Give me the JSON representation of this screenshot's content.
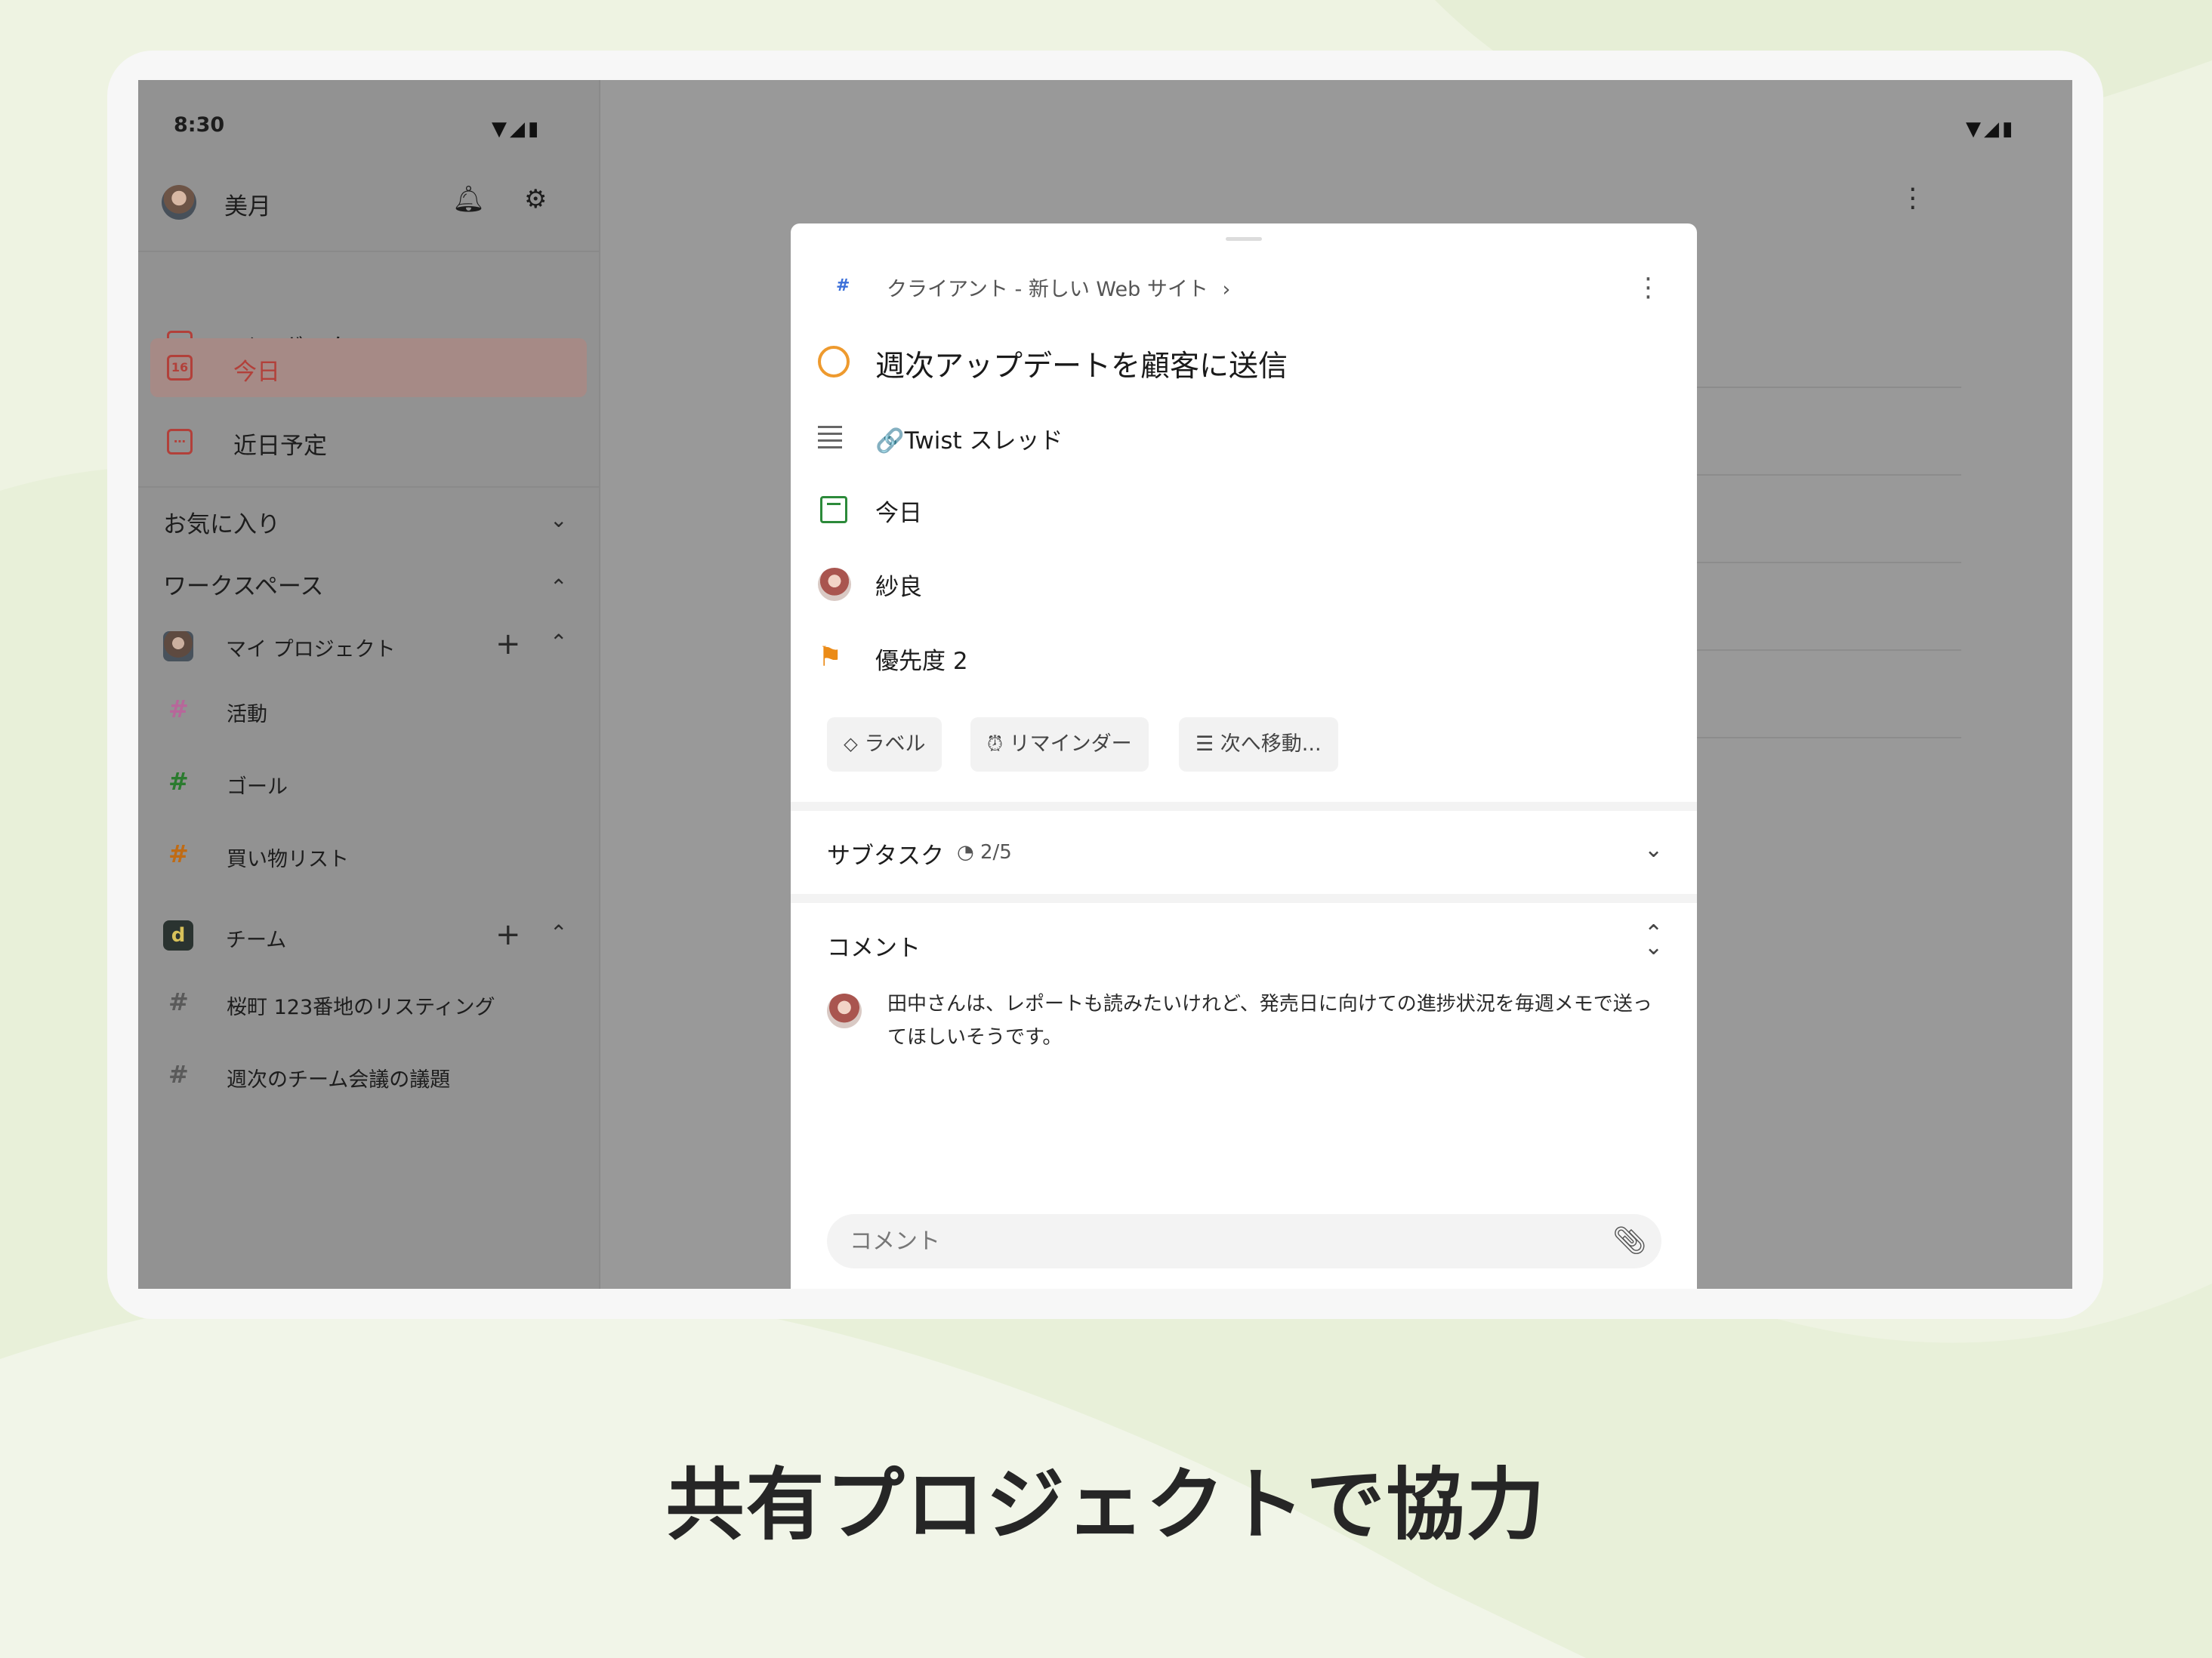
{
  "headline": "共有プロジェクトで協力",
  "status_bar": {
    "time": "8:30",
    "icons": "▼◢▮"
  },
  "sidebar": {
    "user_name": "美月",
    "nav": [
      {
        "label": "インボックス",
        "icon": "inbox-icon"
      },
      {
        "label": "今日",
        "icon": "today-icon",
        "badge": "16",
        "active": true
      },
      {
        "label": "近日予定",
        "icon": "upcoming-icon"
      }
    ],
    "favorites_label": "お気に入り",
    "workspace_label": "ワークスペース",
    "my_projects": {
      "label": "マイ プロジェクト",
      "items": [
        {
          "label": "活動",
          "color": "#b7679a"
        },
        {
          "label": "ゴール",
          "color": "#2b7b2f"
        },
        {
          "label": "買い物リスト",
          "color": "#c06b14"
        }
      ]
    },
    "team": {
      "label": "チーム",
      "badge": "d",
      "items": [
        {
          "label": "桜町 123番地のリスティング",
          "color": "#5a5a5a"
        },
        {
          "label": "週次のチーム会議の議題",
          "color": "#5a5a5a"
        }
      ]
    }
  },
  "task_detail": {
    "breadcrumb": "クライアント - 新しい Web サイト",
    "breadcrumb_hash": "#",
    "breadcrumb_chevron": "›",
    "title": "週次アップデートを顧客に送信",
    "description": "🔗Twist スレッド",
    "due_date": "今日",
    "assignee": "紗良",
    "priority": "優先度 2",
    "chips": {
      "label": "ラベル",
      "reminder": "リマインダー",
      "move": "次へ移動..."
    },
    "subtasks_label": "サブタスク",
    "subtasks_count": "2/5",
    "comments_label": "コメント",
    "comment_body": "田中さんは、レポートも読みたいけれど、発売日に向けての進捗状況を毎週メモで送ってほしいそうです。",
    "comment_placeholder": "コメント"
  },
  "fab_label": "+",
  "colors": {
    "accent": "#b2403a",
    "today_green": "#2c8a3a",
    "priority_orange": "#eb8b17",
    "task_circle": "#ee9a2e",
    "fab": "#a8342f"
  }
}
